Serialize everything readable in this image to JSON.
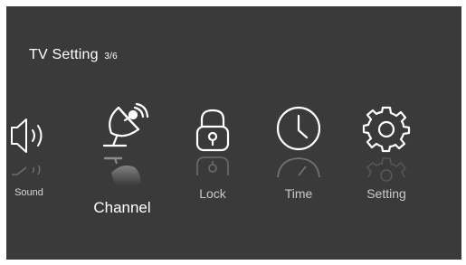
{
  "header": {
    "title": "TV Setting",
    "page_indicator": "3/6"
  },
  "menu": {
    "items": [
      {
        "label": "Sound",
        "icon": "speaker-icon"
      },
      {
        "label": "Channel",
        "icon": "satellite-dish-icon",
        "selected": true
      },
      {
        "label": "Lock",
        "icon": "padlock-icon"
      },
      {
        "label": "Time",
        "icon": "clock-icon"
      },
      {
        "label": "Setting",
        "icon": "gear-icon"
      }
    ]
  },
  "colors": {
    "background": "#3a3a3a",
    "frame": "#ffffff",
    "text": "#ffffff",
    "label_inactive": "#c9c9c9"
  }
}
